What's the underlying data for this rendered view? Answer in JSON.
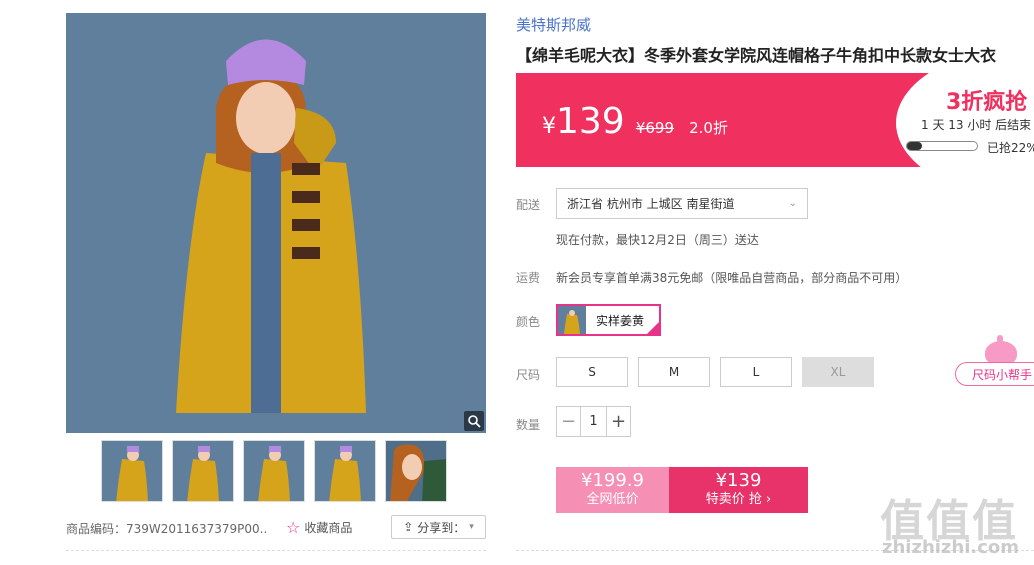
{
  "gallery": {
    "sku": "商品编码：739W2011637379P00...",
    "favorite": "收藏商品",
    "share": "分享到："
  },
  "product": {
    "brand": "美特斯邦威",
    "title": "【绵羊毛呢大衣】冬季外套女学院风连帽格子牛角扣中长款女士大衣"
  },
  "price": {
    "currency": "¥",
    "current": "139",
    "original": "¥699",
    "discount": "2.0折",
    "flash_title": "3折疯抢",
    "countdown": "1  天 13  小时 后结束",
    "sold_text": "已抢22%",
    "sold_fraction": 0.22
  },
  "shipping": {
    "label": "配送",
    "address": "浙江省 杭州市 上城区 南星街道",
    "delivery_note": "现在付款，最快12月2日（周三）送达",
    "freight_label": "运费",
    "freight_note": "新会员专享首单满38元免邮（限唯品自营商品，部分商品不可用）"
  },
  "color": {
    "label": "颜色",
    "selected": "实样姜黄"
  },
  "size": {
    "label": "尺码",
    "options": [
      "S",
      "M",
      "L",
      "XL"
    ],
    "helper": "尺码小帮手"
  },
  "quantity": {
    "label": "数量",
    "value": "1"
  },
  "buy": {
    "network_price": "¥199.9",
    "network_label": "全网低价",
    "sale_price": "¥139",
    "sale_label": "特卖价 抢 ›"
  },
  "watermark": {
    "logo": "值值值",
    "url": "zhizhizhi.com"
  },
  "colors": {
    "accent": "#f0305e",
    "brand_link": "#4a73c9",
    "coat": "#d6a41a",
    "background_photo": "#5f7f9c"
  }
}
